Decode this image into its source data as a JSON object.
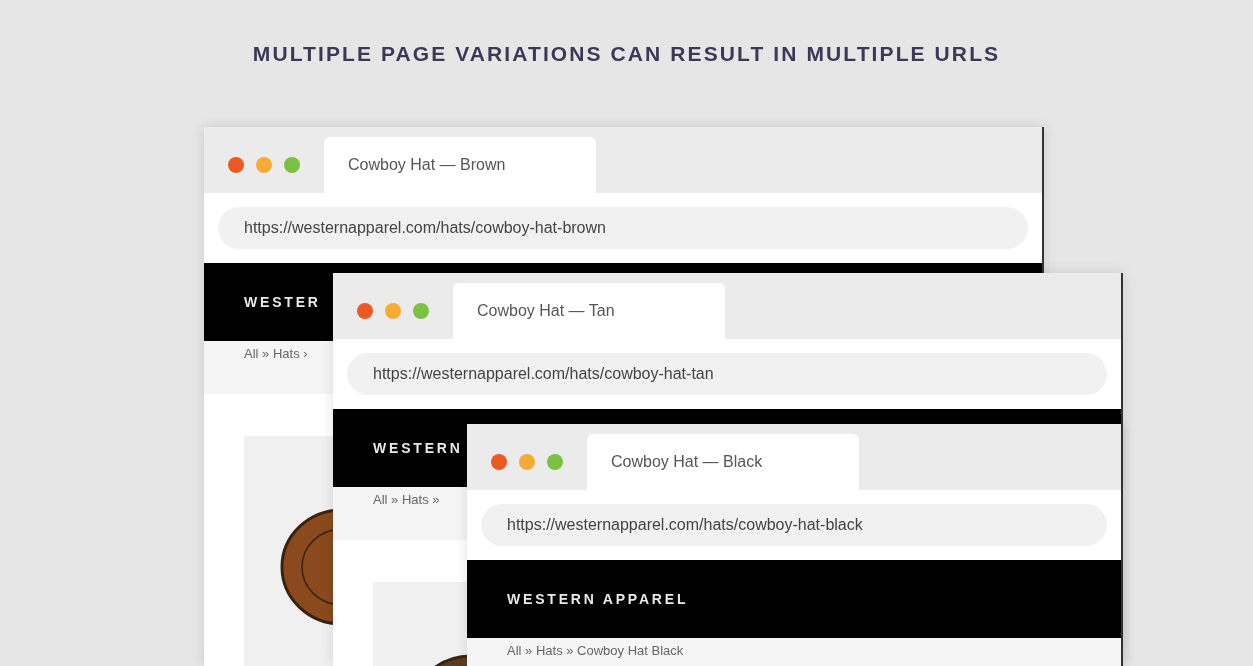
{
  "heading": "MULTIPLE PAGE VARIATIONS CAN RESULT IN MULTIPLE URLS",
  "windows": [
    {
      "tab": "Cowboy Hat — Brown",
      "url": "https://westernapparel.com/hats/cowboy-hat-brown",
      "brand": "WESTER",
      "breadcrumb": "All » Hats ›",
      "color": "#8a4a1e"
    },
    {
      "tab": "Cowboy Hat — Tan",
      "url": "https://westernapparel.com/hats/cowboy-hat-tan",
      "brand": "WESTERN",
      "breadcrumb": "All » Hats »",
      "color": "#5b3b22"
    },
    {
      "tab": "Cowboy Hat — Black",
      "url": "https://westernapparel.com/hats/cowboy-hat-black",
      "brand": "WESTERN APPAREL",
      "breadcrumb": "All » Hats » Cowboy Hat Black"
    }
  ]
}
